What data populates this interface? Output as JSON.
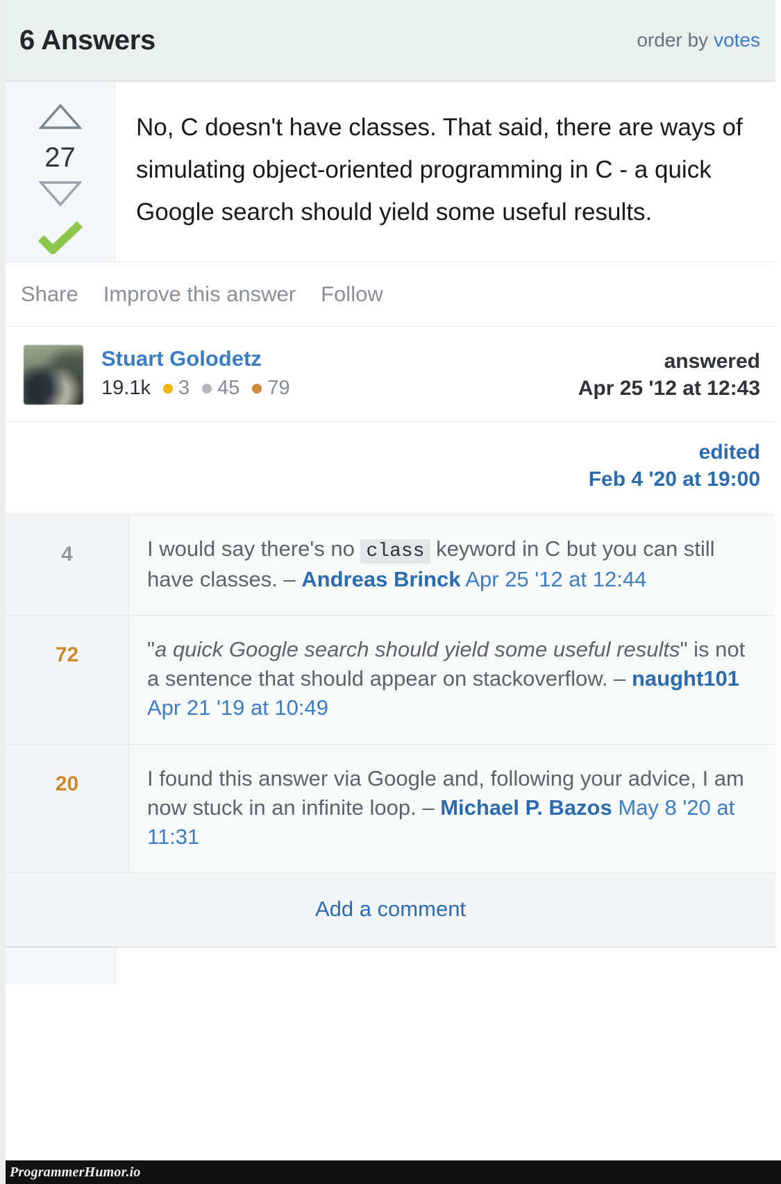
{
  "header": {
    "title": "6 Answers",
    "order_by_label": "order by",
    "order_by_value": "votes"
  },
  "answer": {
    "vote_count": "27",
    "accepted": true,
    "up_arrow_icon": "triangle-up-icon",
    "down_arrow_icon": "triangle-down-icon",
    "accepted_icon": "green-checkmark-icon",
    "body": "No, C doesn't have classes. That said, there are ways of simulating object-oriented programming in C - a quick Google search should yield some useful results.",
    "actions": [
      "Share",
      "Improve this answer",
      "Follow"
    ],
    "author": {
      "name": "Stuart Golodetz",
      "reputation": "19.1k",
      "badges": [
        {
          "type": "gold",
          "count": "3"
        },
        {
          "type": "silver",
          "count": "45"
        },
        {
          "type": "bronze",
          "count": "79"
        }
      ],
      "avatar_icon": "user-avatar-photo"
    },
    "answered": {
      "label": "answered",
      "date": "Apr 25 '12 at 12:43"
    },
    "edited": {
      "label": "edited",
      "date": "Feb 4 '20 at 19:00"
    }
  },
  "comments": [
    {
      "score": "4",
      "hot": false,
      "text_before_code": "I would say there's no ",
      "code": "class",
      "text_after_code": " keyword in C but you can still have classes. – ",
      "user": "Andreas Brinck",
      "time": " Apr 25 '12 at 12:44",
      "italic_quote": "",
      "text_after_quote": ""
    },
    {
      "score": "72",
      "hot": true,
      "text_before_code": "\"",
      "code": "",
      "text_after_code": "",
      "italic_quote": "a quick Google search should yield some useful results",
      "text_after_quote": "\" is not a sentence that should appear on stackoverflow. – ",
      "user": "naught101",
      "time": " Apr 21 '19 at 10:49"
    },
    {
      "score": "20",
      "hot": true,
      "text_before_code": "I found this answer via Google and, following your advice, I am now stuck in an infinite loop. – ",
      "code": "",
      "text_after_code": "",
      "italic_quote": "",
      "text_after_quote": "",
      "user": "Michael P. Bazos",
      "time": " May 8 '20 at 11:31"
    }
  ],
  "add_comment_label": "Add a comment",
  "watermark": "ProgrammerHumor.io",
  "colors": {
    "link_blue": "#3b7cc4",
    "link_blue_bold": "#2b6bb0",
    "accent_green": "#8cc64b",
    "hot_orange": "#cc8a29",
    "badge_gold": "#f1b600",
    "badge_silver": "#b4b8bc",
    "badge_bronze": "#d1883b",
    "header_bg": "#eaf0ee"
  }
}
